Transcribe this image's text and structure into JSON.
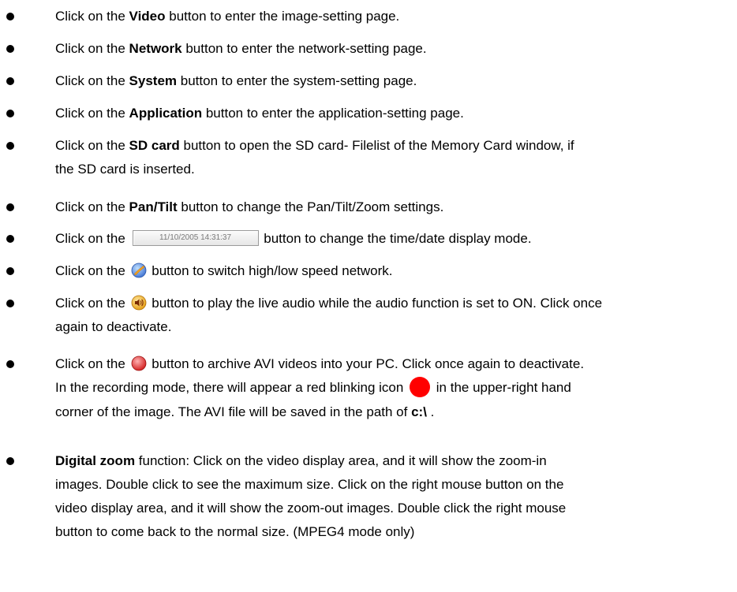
{
  "items": [
    {
      "pre": "Click on the ",
      "bold": "Video",
      "post": " button to enter the image-setting page."
    },
    {
      "pre": "Click on the ",
      "bold": "Network",
      "post": " button to enter the network-setting page."
    },
    {
      "pre": "Click on the ",
      "bold": "System",
      "post": " button to enter the system-setting page."
    },
    {
      "pre": "Click on the ",
      "bold": "Application",
      "post": " button to enter the application-setting page."
    },
    {
      "pre": "Click on the ",
      "bold": "SD card",
      "post": " button to open the SD card- Filelist of the Memory Card window, if",
      "cont": "the SD card is inserted."
    },
    {
      "pre": "Click on the ",
      "bold": "Pan/Tilt",
      "post": " button to change the Pan/Tilt/Zoom settings."
    },
    {
      "pre": "Click on the ",
      "timestamp_label": "11/10/2005 14:31:37",
      "post": " button to change the time/date display mode."
    },
    {
      "pre": "Click on the ",
      "icon": "network-speed-icon",
      "post": " button to switch high/low speed network."
    },
    {
      "pre": "Click on the ",
      "icon": "audio-speaker-icon",
      "post": " button to play the live audio while the audio function is set to ON. Click once",
      "cont": "again to deactivate."
    },
    {
      "pre": "Click on the ",
      "icon": "record-icon",
      "post": " button to archive AVI videos into your PC. Click once again to deactivate.",
      "line2_pre": "In the recording mode, there will appear a red blinking icon ",
      "line2_post": " in the upper-right hand",
      "line3_pre": "corner of the image. The AVI file will be saved in the path of ",
      "line3_bold": "c:\\",
      "line3_post": " ."
    },
    {
      "bold": "Digital zoom",
      "post": " function: Click on the video display area, and it will show the zoom-in",
      "lines": [
        "images. Double click to see the maximum size. Click on the right mouse button on the",
        "video display area, and it will show the zoom-out images. Double click the right mouse",
        "button to come back to the normal size. (MPEG4 mode only)"
      ]
    }
  ],
  "icons": {
    "network_speed_color": "#f0a020",
    "network_speed_accent": "#3c6fd0",
    "audio_color": "#f3b21f",
    "record_color": "#e02020",
    "blink_color": "#ff0000"
  }
}
